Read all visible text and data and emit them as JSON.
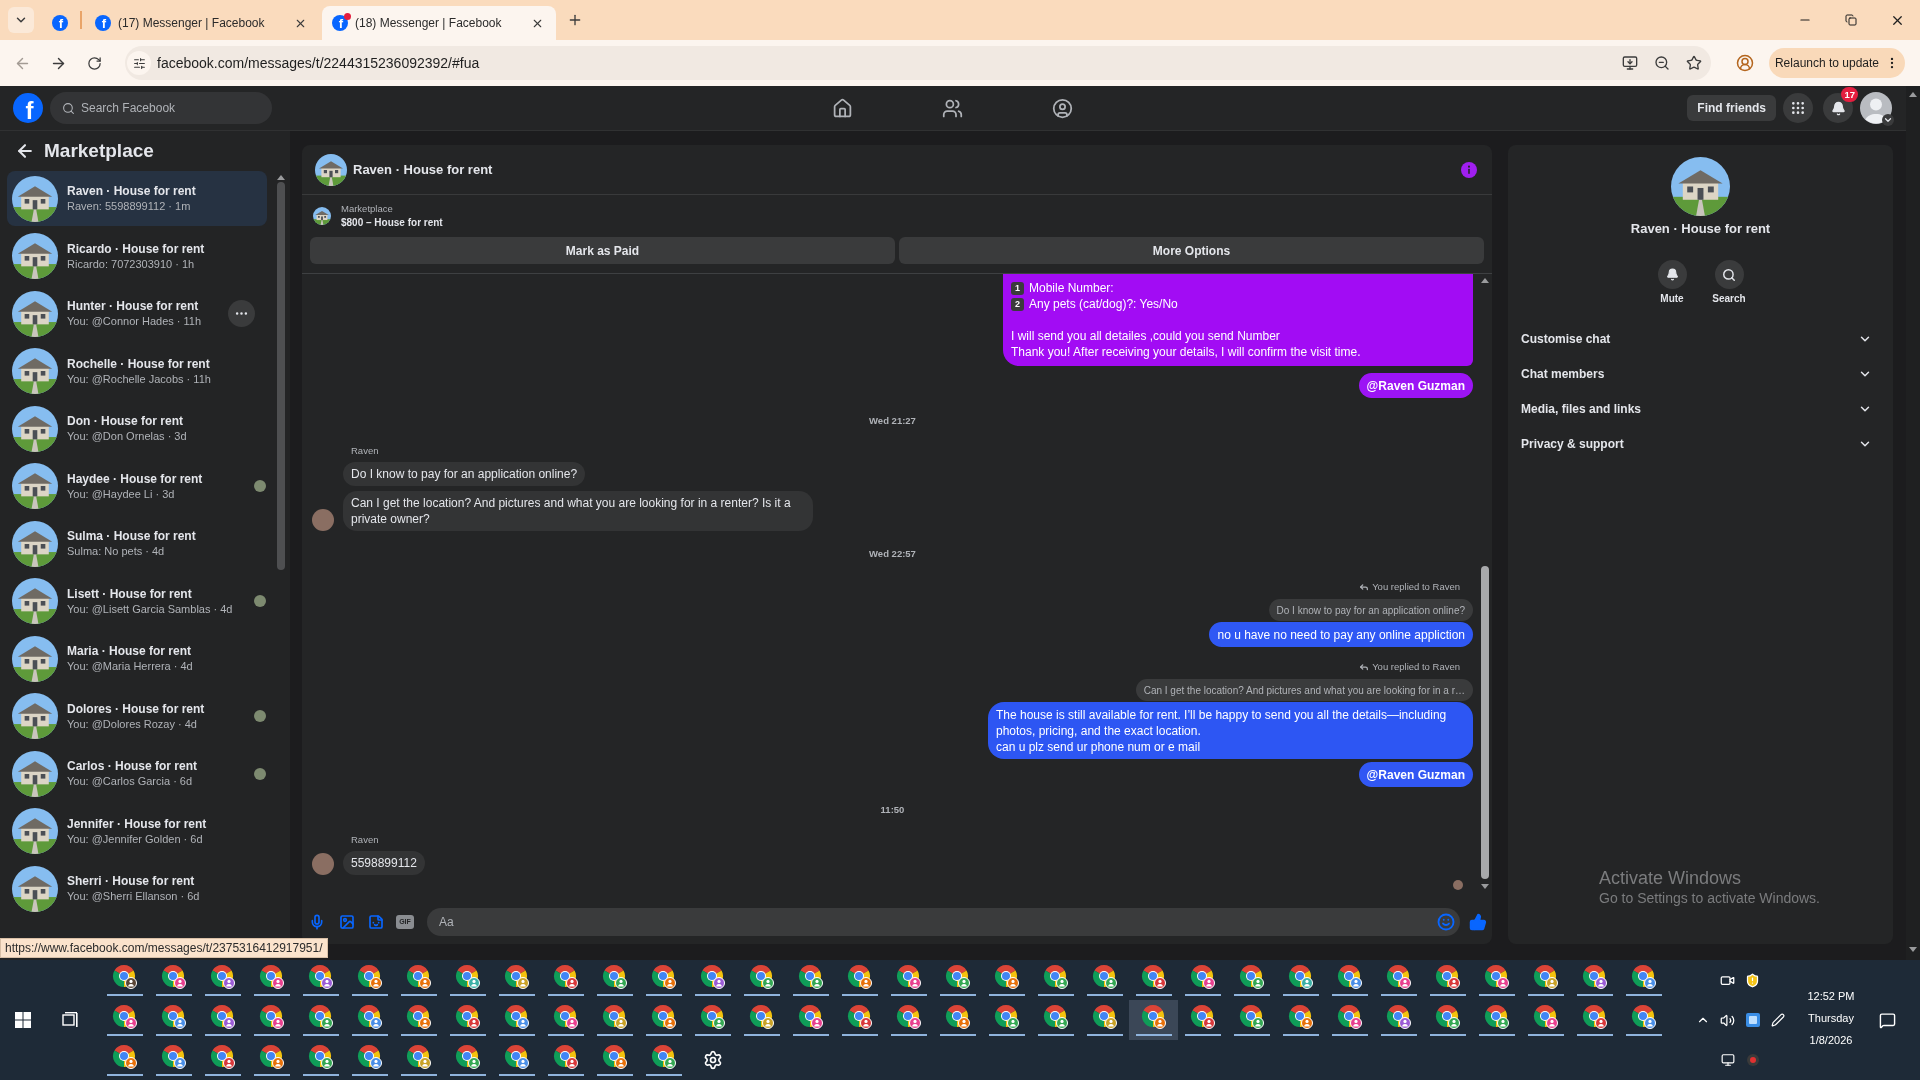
{
  "browser": {
    "tabs": [
      {
        "kind": "pinned",
        "favicon": "f",
        "selected": false,
        "notification_dot": false
      },
      {
        "kind": "page",
        "favicon": "f",
        "title": "(17) Messenger | Facebook",
        "selected": false,
        "notification_dot": false
      },
      {
        "kind": "page",
        "favicon": "f",
        "title": "(18) Messenger | Facebook",
        "selected": true,
        "notification_dot": true
      }
    ],
    "url": "facebook.com/messages/t/2244315236092392/#fua",
    "update_button": "Relaunch to update"
  },
  "header": {
    "logo": "f",
    "search": {
      "placeholder": "Search Facebook"
    },
    "nav": [
      {
        "kind": "home"
      },
      {
        "kind": "friends"
      },
      {
        "kind": "groups"
      }
    ],
    "find_friends": "Find friends",
    "notification_count": "17"
  },
  "sidebar": {
    "title": "Marketplace",
    "items": [
      {
        "title": "Raven · House for rent",
        "preview": "Raven: 5598899112 · 1m",
        "selected": true,
        "more_button": false,
        "seen": false
      },
      {
        "title": "Ricardo · House for rent",
        "preview": "Ricardo: 7072303910 · 1h",
        "selected": false,
        "more_button": false,
        "seen": false
      },
      {
        "title": "Hunter · House for rent",
        "preview": "You: @Connor Hades · 11h",
        "selected": false,
        "more_button": true,
        "seen": false
      },
      {
        "title": "Rochelle · House for rent",
        "preview": "You: @Rochelle Jacobs · 11h",
        "selected": false,
        "more_button": false,
        "seen": false
      },
      {
        "title": "Don · House for rent",
        "preview": "You: @Don Ornelas · 3d",
        "selected": false,
        "more_button": false,
        "seen": false
      },
      {
        "title": "Haydee · House for rent",
        "preview": "You: @Haydee Li · 3d",
        "selected": false,
        "more_button": false,
        "seen": true
      },
      {
        "title": "Sulma · House for rent",
        "preview": "Sulma: No pets · 4d",
        "selected": false,
        "more_button": false,
        "seen": false
      },
      {
        "title": "Lisett · House for rent",
        "preview": "You: @Lisett Garcia Samblas · 4d",
        "selected": false,
        "more_button": false,
        "seen": true
      },
      {
        "title": "Maria · House for rent",
        "preview": "You: @Maria Herrera · 4d",
        "selected": false,
        "more_button": false,
        "seen": false
      },
      {
        "title": "Dolores · House for rent",
        "preview": "You: @Dolores Rozay · 4d",
        "selected": false,
        "more_button": false,
        "seen": true
      },
      {
        "title": "Carlos · House for rent",
        "preview": "You: @Carlos Garcia · 6d",
        "selected": false,
        "more_button": false,
        "seen": true
      },
      {
        "title": "Jennifer · House for rent",
        "preview": "You: @Jennifer Golden · 6d",
        "selected": false,
        "more_button": false,
        "seen": false
      },
      {
        "title": "Sherri · House for rent",
        "preview": "You: @Sherri Ellanson · 6d",
        "selected": false,
        "more_button": false,
        "seen": false
      }
    ]
  },
  "status_url": "https://www.facebook.com/messages/t/2375316412917951/",
  "chat": {
    "title": "Raven · House for rent",
    "listing": {
      "label": "Marketplace",
      "title": "$800 – House for rent"
    },
    "actions": [
      "Mark as Paid",
      "More Options"
    ],
    "messages": [
      {
        "kind": "outgoing",
        "color": "#a20cf4",
        "blocks": [
          {
            "kind": "numbered",
            "number": "1",
            "text": "Mobile Number:"
          },
          {
            "kind": "numbered",
            "number": "2",
            "text": "Any pets (cat/dog)?: Yes/No"
          },
          {
            "kind": "paragraph",
            "text": "I will send you all detailes ,could you send Number\nThank you! After receiving your details, I will confirm the visit time."
          }
        ]
      },
      {
        "kind": "mention",
        "color": "#9c14f5",
        "text": "@Raven Guzman"
      },
      {
        "kind": "timestamp",
        "text": "Wed 21:27"
      },
      {
        "kind": "incoming",
        "sender": "Raven",
        "bubbles": [
          "Do I know to pay for an application online?",
          "Can I get the location? And pictures and what you are looking for in a renter? Is it a private owner?"
        ]
      },
      {
        "kind": "timestamp",
        "text": "Wed 22:57"
      },
      {
        "kind": "reply",
        "label": "You replied to Raven",
        "quote": "Do I know to pay for an application online?",
        "text": "no u have no need to pay any online appliction",
        "color": "#2f58f4"
      },
      {
        "kind": "reply",
        "label": "You replied to Raven",
        "quote": "Can I get the location? And pictures and what you are looking for in a r…",
        "text": "The house is still available for rent. I’ll be happy to send you all the details—including photos, pricing, and the exact location.\ncan u plz send ur phone num or e mail",
        "color": "#2d56f3"
      },
      {
        "kind": "mention",
        "color": "#3157f4",
        "text": "@Raven Guzman"
      },
      {
        "kind": "timestamp",
        "text": "11:50"
      },
      {
        "kind": "incoming",
        "sender": "Raven",
        "bubbles": [
          "5598899112"
        ]
      },
      {
        "kind": "seen"
      }
    ],
    "composer": {
      "gif_label": "GIF",
      "placeholder": "Aa"
    }
  },
  "details": {
    "title": "Raven · House for rent",
    "actions": [
      {
        "kind": "mute",
        "label": "Mute"
      },
      {
        "kind": "search",
        "label": "Search"
      }
    ],
    "sections": [
      {
        "label": "Customise chat",
        "expanded": false
      },
      {
        "label": "Chat members",
        "expanded": false
      },
      {
        "label": "Media, files and links",
        "expanded": false
      },
      {
        "label": "Privacy & support",
        "expanded": false
      }
    ]
  },
  "os_notice": {
    "title": "Activate Windows",
    "text": "Go to Settings to activate Windows."
  },
  "taskbar": {
    "apps": [
      {
        "kind": "browser",
        "color": "#5a4636",
        "selected": false
      },
      {
        "kind": "browser",
        "color": "#e8408f",
        "selected": false
      },
      {
        "kind": "browser",
        "color": "#9b5cd6",
        "selected": false
      },
      {
        "kind": "browser",
        "color": "#e8408f",
        "selected": false
      },
      {
        "kind": "browser",
        "color": "#9b5cd6",
        "selected": false
      },
      {
        "kind": "browser",
        "color": "#e8710a",
        "selected": false
      },
      {
        "kind": "browser",
        "color": "#e8710a",
        "selected": false
      },
      {
        "kind": "browser",
        "color": "#3bb0a6",
        "selected": false
      },
      {
        "kind": "browser",
        "color": "#c9a227",
        "selected": false
      },
      {
        "kind": "browser",
        "color": "#d9383a",
        "selected": false
      },
      {
        "kind": "browser",
        "color": "#34a853",
        "selected": false
      },
      {
        "kind": "browser",
        "color": "#e8710a",
        "selected": false
      },
      {
        "kind": "browser",
        "color": "#9b5cd6",
        "selected": false
      },
      {
        "kind": "browser",
        "color": "#34a853",
        "selected": false
      },
      {
        "kind": "browser",
        "color": "#34a853",
        "selected": false
      },
      {
        "kind": "browser",
        "color": "#e8710a",
        "selected": false
      },
      {
        "kind": "browser",
        "color": "#e8408f",
        "selected": false
      },
      {
        "kind": "browser",
        "color": "#34a853",
        "selected": false
      },
      {
        "kind": "browser",
        "color": "#e8710a",
        "selected": false
      },
      {
        "kind": "browser",
        "color": "#34a853",
        "selected": false
      },
      {
        "kind": "browser",
        "color": "#34a853",
        "selected": false
      },
      {
        "kind": "browser",
        "color": "#d9383a",
        "selected": false
      },
      {
        "kind": "browser",
        "color": "#e8408f",
        "selected": false
      },
      {
        "kind": "browser",
        "color": "#34a853",
        "selected": false
      },
      {
        "kind": "browser",
        "color": "#3bb0a6",
        "selected": false
      },
      {
        "kind": "browser",
        "color": "#4a8fe7",
        "selected": false
      },
      {
        "kind": "browser",
        "color": "#e8408f",
        "selected": false
      },
      {
        "kind": "browser",
        "color": "#d9383a",
        "selected": false
      },
      {
        "kind": "browser",
        "color": "#e8408f",
        "selected": false
      },
      {
        "kind": "browser",
        "color": "#c9a227",
        "selected": false
      },
      {
        "kind": "browser",
        "color": "#9b5cd6",
        "selected": false
      },
      {
        "kind": "browser",
        "color": "#4a8fe7",
        "selected": false
      },
      {
        "kind": "browser",
        "color": "#e8408f",
        "selected": false
      },
      {
        "kind": "browser",
        "color": "#4a8fe7",
        "selected": false
      },
      {
        "kind": "browser",
        "color": "#9b5cd6",
        "selected": false
      },
      {
        "kind": "browser",
        "color": "#e8408f",
        "selected": false
      },
      {
        "kind": "browser",
        "color": "#34a853",
        "selected": false
      },
      {
        "kind": "browser",
        "color": "#4a8fe7",
        "selected": false
      },
      {
        "kind": "browser",
        "color": "#e8710a",
        "selected": false
      },
      {
        "kind": "browser",
        "color": "#d9383a",
        "selected": false
      },
      {
        "kind": "browser",
        "color": "#4a8fe7",
        "selected": false
      },
      {
        "kind": "browser",
        "color": "#e8408f",
        "selected": false
      },
      {
        "kind": "browser",
        "color": "#c9a227",
        "selected": false
      },
      {
        "kind": "browser",
        "color": "#e8710a",
        "selected": false
      },
      {
        "kind": "browser",
        "color": "#34a853",
        "selected": false
      },
      {
        "kind": "browser",
        "color": "#c9a227",
        "selected": false
      },
      {
        "kind": "browser",
        "color": "#e8408f",
        "selected": false
      },
      {
        "kind": "browser",
        "color": "#d9383a",
        "selected": false
      },
      {
        "kind": "browser",
        "color": "#e8408f",
        "selected": false
      },
      {
        "kind": "browser",
        "color": "#e8710a",
        "selected": false
      },
      {
        "kind": "browser",
        "color": "#34a853",
        "selected": false
      },
      {
        "kind": "browser",
        "color": "#34a853",
        "selected": false
      },
      {
        "kind": "browser",
        "color": "#c9a227",
        "selected": false
      },
      {
        "kind": "browser",
        "color": "#e8710a",
        "selected": true
      },
      {
        "kind": "browser",
        "color": "#d9383a",
        "selected": false
      },
      {
        "kind": "browser",
        "color": "#34a853",
        "selected": false
      },
      {
        "kind": "browser",
        "color": "#e8710a",
        "selected": false
      },
      {
        "kind": "browser",
        "color": "#e8408f",
        "selected": false
      },
      {
        "kind": "browser",
        "color": "#9b5cd6",
        "selected": false
      },
      {
        "kind": "browser",
        "color": "#34a853",
        "selected": false
      },
      {
        "kind": "browser",
        "color": "#34a853",
        "selected": false
      },
      {
        "kind": "browser",
        "color": "#e8408f",
        "selected": false
      },
      {
        "kind": "browser",
        "color": "#d9383a",
        "selected": false
      },
      {
        "kind": "browser",
        "color": "#4a8fe7",
        "selected": false
      },
      {
        "kind": "browser",
        "color": "#e8710a",
        "selected": false
      },
      {
        "kind": "browser",
        "color": "#4a8fe7",
        "selected": false
      },
      {
        "kind": "browser",
        "color": "#d9383a",
        "selected": false
      },
      {
        "kind": "browser",
        "color": "#e8710a",
        "selected": false
      },
      {
        "kind": "browser",
        "color": "#34a853",
        "selected": false
      },
      {
        "kind": "browser",
        "color": "#4a8fe7",
        "selected": false
      },
      {
        "kind": "browser",
        "color": "#c9a227",
        "selected": false
      },
      {
        "kind": "browser",
        "color": "#34a853",
        "selected": false
      },
      {
        "kind": "browser",
        "color": "#4a8fe7",
        "selected": false
      },
      {
        "kind": "browser",
        "color": "#d9383a",
        "selected": false
      },
      {
        "kind": "browser",
        "color": "#e8710a",
        "selected": false
      },
      {
        "kind": "browser",
        "color": "#34a853",
        "selected": false
      },
      {
        "kind": "settings",
        "selected": false
      }
    ],
    "clock": {
      "time": "12:52 PM",
      "day": "Thursday",
      "date": "1/8/2026"
    }
  }
}
